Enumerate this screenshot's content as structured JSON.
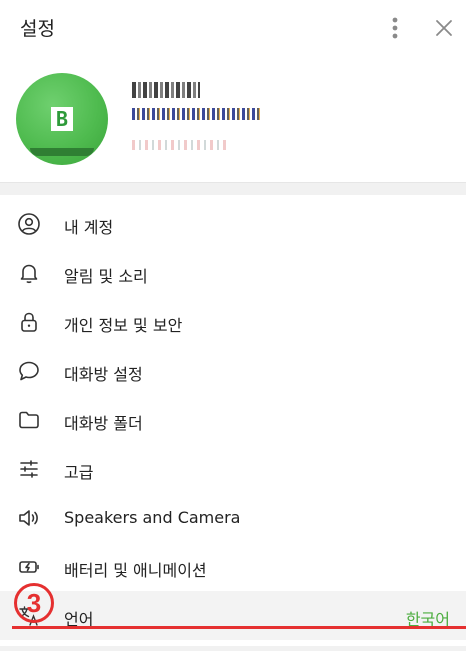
{
  "header": {
    "title": "설정",
    "more_icon": "more-vertical-icon",
    "close_icon": "close-icon"
  },
  "profile": {
    "avatar_letter": "B",
    "avatar_color": "#4fbb4f"
  },
  "menu": {
    "items": [
      {
        "label": "내 계정",
        "icon": "person-circle-icon"
      },
      {
        "label": "알림 및 소리",
        "icon": "bell-icon"
      },
      {
        "label": "개인 정보 및 보안",
        "icon": "lock-icon"
      },
      {
        "label": "대화방 설정",
        "icon": "chat-bubble-icon"
      },
      {
        "label": "대화방 폴더",
        "icon": "folder-icon"
      },
      {
        "label": "고급",
        "icon": "sliders-icon"
      },
      {
        "label": "Speakers and Camera",
        "icon": "speaker-icon"
      },
      {
        "label": "배터리 및 애니메이션",
        "icon": "battery-icon"
      },
      {
        "label": "언어",
        "icon": "language-icon",
        "value": "한국어"
      }
    ]
  },
  "annotation": {
    "number": "3",
    "color": "#e53030"
  },
  "colors": {
    "accent_green": "#4cad3f"
  }
}
